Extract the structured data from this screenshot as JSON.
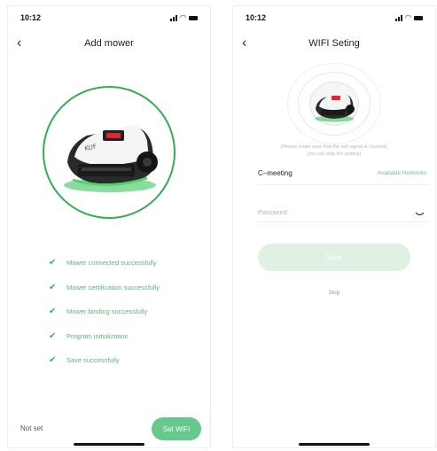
{
  "add_mower": {
    "status_bar": {
      "time": "10:12"
    },
    "title": "Add mower",
    "steps": [
      {
        "label": "Mower connected successfully"
      },
      {
        "label": "Mower certification successfully"
      },
      {
        "label": "Mower binding successfully"
      },
      {
        "label": "Program initialization"
      },
      {
        "label": "Save successfully"
      }
    ],
    "check_glyph": "✔",
    "bottom": {
      "status_label": "Not set",
      "set_wifi_label": "Set WiFi"
    }
  },
  "wifi_setting": {
    "status_bar": {
      "time": "10:12"
    },
    "title": "WIFI Seting",
    "hint_line_1": "(Please make sure that the wifi signal is covered,",
    "hint_line_2": "you can skip the setting)",
    "network_name": "C–meeting",
    "available_networks_label": "Available Networks",
    "password_placeholder": "Password",
    "save_label": "Save",
    "skip_label": "Skip"
  },
  "colors": {
    "accent_green": "#2fae54",
    "button_green": "#66c88a",
    "save_disabled": "#dff1e3"
  },
  "icons": {
    "back": "chevron-left-icon",
    "check": "check-icon",
    "eye": "eye-closed-icon",
    "signal": "signal-icon",
    "wifi": "wifi-icon",
    "battery": "battery-icon"
  }
}
